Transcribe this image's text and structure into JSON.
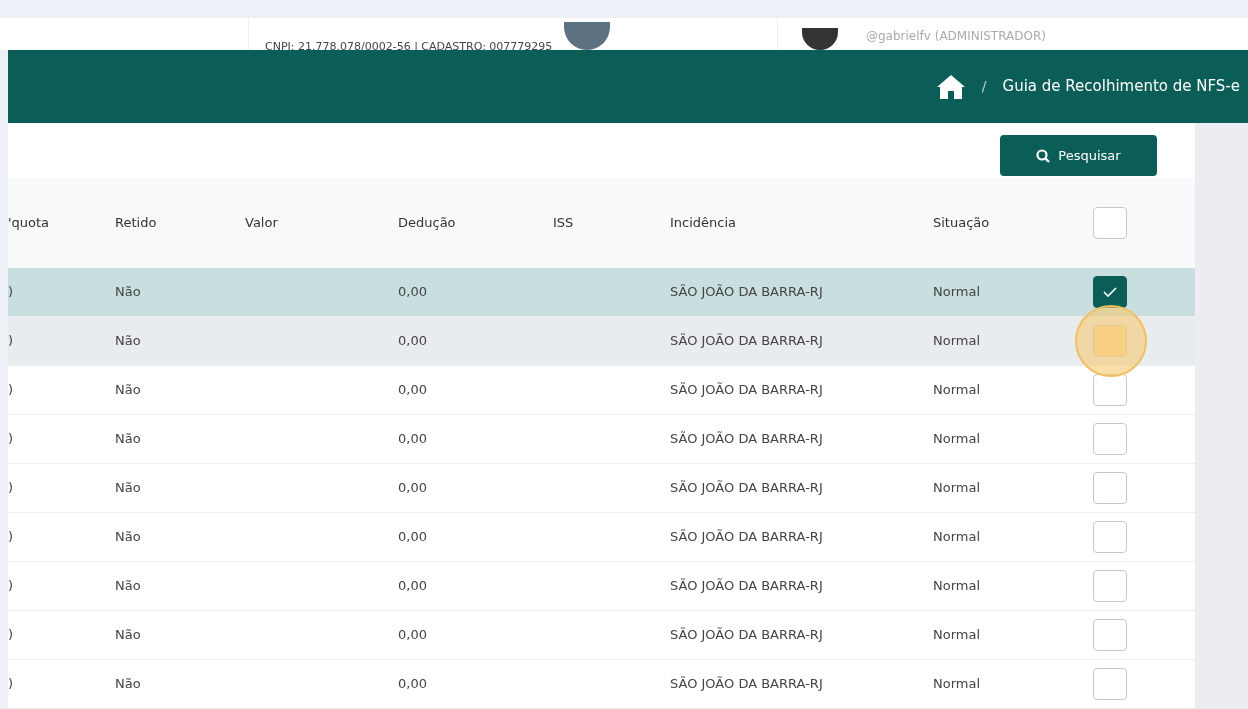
{
  "top_bar": {
    "company_info": "CNPJ: 21.778.078/0002-56 | CADASTRO: 007779295",
    "user": "@gabrielfv (ADMINISTRADOR)"
  },
  "breadcrumb": {
    "separator": "/",
    "current": "Guia de Recolhimento de NFS-e"
  },
  "search_button": {
    "label": "Pesquisar"
  },
  "table": {
    "columns": [
      "'quota",
      "Retido",
      "Valor",
      "Dedução",
      "ISS",
      "Incidência",
      "Situação"
    ],
    "select_all": {
      "checked": false
    },
    "rows": [
      {
        "column_1": ")",
        "retido": "Não",
        "deducao": "0,00",
        "incidencia": "SÃO JOÃO DA BARRA-RJ",
        "situacao": "Normal",
        "checked": true,
        "selected": true,
        "highlighted": false
      },
      {
        "column_1": ")",
        "retido": "Não",
        "deducao": "0,00",
        "incidencia": "SÃO JOÃO DA BARRA-RJ",
        "situacao": "Normal",
        "checked": false,
        "selected": false,
        "highlighted": true
      },
      {
        "column_1": ")",
        "retido": "Não",
        "deducao": "0,00",
        "incidencia": "SÃO JOÃO DA BARRA-RJ",
        "situacao": "Normal",
        "checked": false,
        "selected": false,
        "highlighted": false
      },
      {
        "column_1": ")",
        "retido": "Não",
        "deducao": "0,00",
        "incidencia": "SÃO JOÃO DA BARRA-RJ",
        "situacao": "Normal",
        "checked": false,
        "selected": false,
        "highlighted": false
      },
      {
        "column_1": ")",
        "retido": "Não",
        "deducao": "0,00",
        "incidencia": "SÃO JOÃO DA BARRA-RJ",
        "situacao": "Normal",
        "checked": false,
        "selected": false,
        "highlighted": false
      },
      {
        "column_1": ")",
        "retido": "Não",
        "deducao": "0,00",
        "incidencia": "SÃO JOÃO DA BARRA-RJ",
        "situacao": "Normal",
        "checked": false,
        "selected": false,
        "highlighted": false
      },
      {
        "column_1": ")",
        "retido": "Não",
        "deducao": "0,00",
        "incidencia": "SÃO JOÃO DA BARRA-RJ",
        "situacao": "Normal",
        "checked": false,
        "selected": false,
        "highlighted": false
      },
      {
        "column_1": ")",
        "retido": "Não",
        "deducao": "0,00",
        "incidencia": "SÃO JOÃO DA BARRA-RJ",
        "situacao": "Normal",
        "checked": false,
        "selected": false,
        "highlighted": false
      },
      {
        "column_1": ")",
        "retido": "Não",
        "deducao": "0,00",
        "incidencia": "SÃO JOÃO DA BARRA-RJ",
        "situacao": "Normal",
        "checked": false,
        "selected": false,
        "highlighted": false
      }
    ]
  }
}
